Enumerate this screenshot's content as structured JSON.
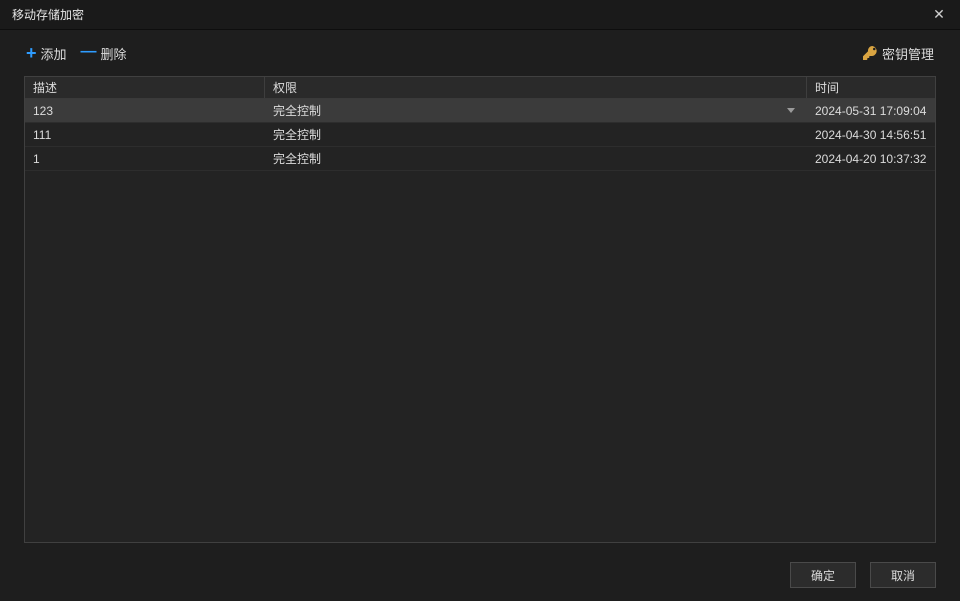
{
  "title": "移动存储加密",
  "toolbar": {
    "add_label": "添加",
    "delete_label": "删除",
    "key_mgmt_label": "密钥管理"
  },
  "table": {
    "headers": {
      "description": "描述",
      "permission": "权限",
      "time": "时间"
    },
    "rows": [
      {
        "description": "123",
        "permission": "完全控制",
        "time": "2024-05-31 17:09:04",
        "selected": true
      },
      {
        "description": "111",
        "permission": "完全控制",
        "time": "2024-04-30 14:56:51",
        "selected": false
      },
      {
        "description": "1",
        "permission": "完全控制",
        "time": "2024-04-20 10:37:32",
        "selected": false
      }
    ]
  },
  "footer": {
    "ok_label": "确定",
    "cancel_label": "取消"
  }
}
